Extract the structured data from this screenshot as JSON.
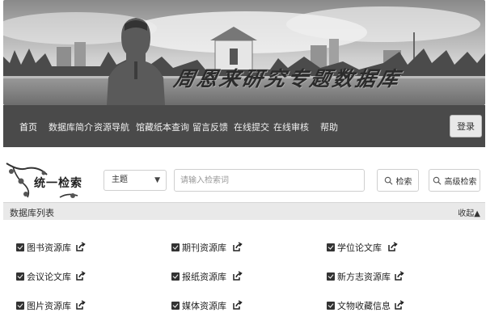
{
  "banner": {
    "title": "周恩来研究专题数据库"
  },
  "nav": {
    "items": [
      "首页",
      "数据库简介",
      "资源导航",
      "馆藏纸本查询",
      "留言反馈",
      "在线提交",
      "在线审核",
      "帮助"
    ],
    "login": "登录"
  },
  "search": {
    "logo_text": "统一检索",
    "select_value": "主题",
    "placeholder": "请输入检索词",
    "search_button": "检索",
    "advanced_button": "高级检索"
  },
  "list": {
    "title": "数据库列表",
    "collapse": "收起▲",
    "items": [
      "图书资源库",
      "期刊资源库",
      "学位论文库",
      "会议论文库",
      "报纸资源库",
      "新方志资源库",
      "图片资源库",
      "媒体资源库",
      "文物收藏信息"
    ]
  },
  "icons": {
    "checkbox": "checked-checkbox-icon",
    "share": "share-icon",
    "search": "magnifier-icon",
    "caret": "chevron-down-icon"
  }
}
